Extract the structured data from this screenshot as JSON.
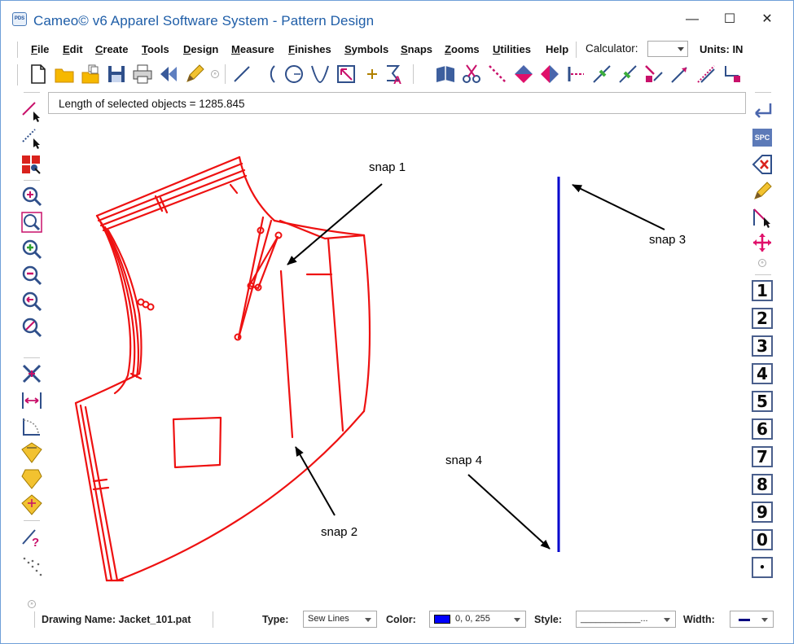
{
  "window": {
    "title": "Cameo© v6 Apparel Software System - Pattern Design",
    "icon_text": "PDS",
    "controls": {
      "minimize": "—",
      "maximize": "☐",
      "close": "✕"
    }
  },
  "menu": {
    "items": [
      {
        "label": "File",
        "underline": "F",
        "rest": "ile"
      },
      {
        "label": "Edit",
        "underline": "E",
        "rest": "dit"
      },
      {
        "label": "Create",
        "underline": "C",
        "rest": "reate"
      },
      {
        "label": "Tools",
        "underline": "T",
        "rest": "ools"
      },
      {
        "label": "Design",
        "underline": "D",
        "rest": "esign"
      },
      {
        "label": "Measure",
        "underline": "M",
        "rest": "easure"
      },
      {
        "label": "Finishes",
        "underline": "F",
        "rest": "inishes"
      },
      {
        "label": "Symbols",
        "underline": "S",
        "rest": "ymbols"
      },
      {
        "label": "Snaps",
        "underline": "S",
        "rest": "naps"
      },
      {
        "label": "Zooms",
        "underline": "Z",
        "rest": "ooms"
      },
      {
        "label": "Utilities",
        "underline": "U",
        "rest": "tilities"
      },
      {
        "label": "Help",
        "underline": "",
        "rest": "Help"
      }
    ],
    "calculator_label": "Calculator:",
    "calculator_value": "",
    "units_label": "Units: IN"
  },
  "info_field": {
    "text": "Length of selected objects = 1285.845"
  },
  "toolbar_icons": [
    "new-file-icon",
    "open-folder-icon",
    "open-multiple-icon",
    "save-icon",
    "print-icon",
    "back-arrows-icon",
    "pencil-icon",
    "expand-icon",
    "line-tool-icon",
    "arc-tool-icon",
    "circle-tool-icon",
    "v-curve-icon",
    "box-arrow-icon",
    "cross-point-icon",
    "text-tool-icon",
    "book-icon",
    "scissors-icon",
    "dotted-line-icon",
    "mirror-horizontal-icon",
    "mirror-vertical-icon",
    "line-end-icon",
    "knife-icon",
    "knife-alt-icon",
    "notch-icon",
    "arrow-line-icon",
    "measure-line-icon",
    "corner-arrow-icon"
  ],
  "left_icons": [
    "select-line-icon",
    "select-dotted-icon",
    "select-block-icon",
    "zoom-in-icon",
    "zoom-window-icon",
    "zoom-plus-icon",
    "zoom-minus-icon",
    "zoom-previous-icon",
    "zoom-cancel-icon",
    "cross-move-icon",
    "width-arrows-icon",
    "angle-dotted-icon",
    "diamond-yellow-icon",
    "pentagon-yellow-icon",
    "diamond-cross-icon",
    "line-question-icon",
    "dots-icon"
  ],
  "right_icons": {
    "top": [
      "return-arrow-icon",
      "spc-icon",
      "delete-icon",
      "pencil-icon",
      "line-select-icon",
      "move-cross-icon"
    ],
    "spc_label": "SPC",
    "numbers": [
      "1",
      "2",
      "3",
      "4",
      "5",
      "6",
      "7",
      "8",
      "9",
      "0",
      "•"
    ]
  },
  "canvas": {
    "annotations": [
      {
        "label": "snap 1"
      },
      {
        "label": "snap 2"
      },
      {
        "label": "snap 3"
      },
      {
        "label": "snap 4"
      }
    ],
    "pattern_color": "#ee1111",
    "selected_line_color": "#0000cc"
  },
  "statusbar": {
    "drawing_name": "Drawing Name: Jacket_101.pat",
    "type_label": "Type:",
    "type_value": "Sew Lines",
    "color_label": "Color:",
    "color_value": "0, 0, 255",
    "style_label": "Style:",
    "style_value": "____________...",
    "width_label": "Width:"
  }
}
